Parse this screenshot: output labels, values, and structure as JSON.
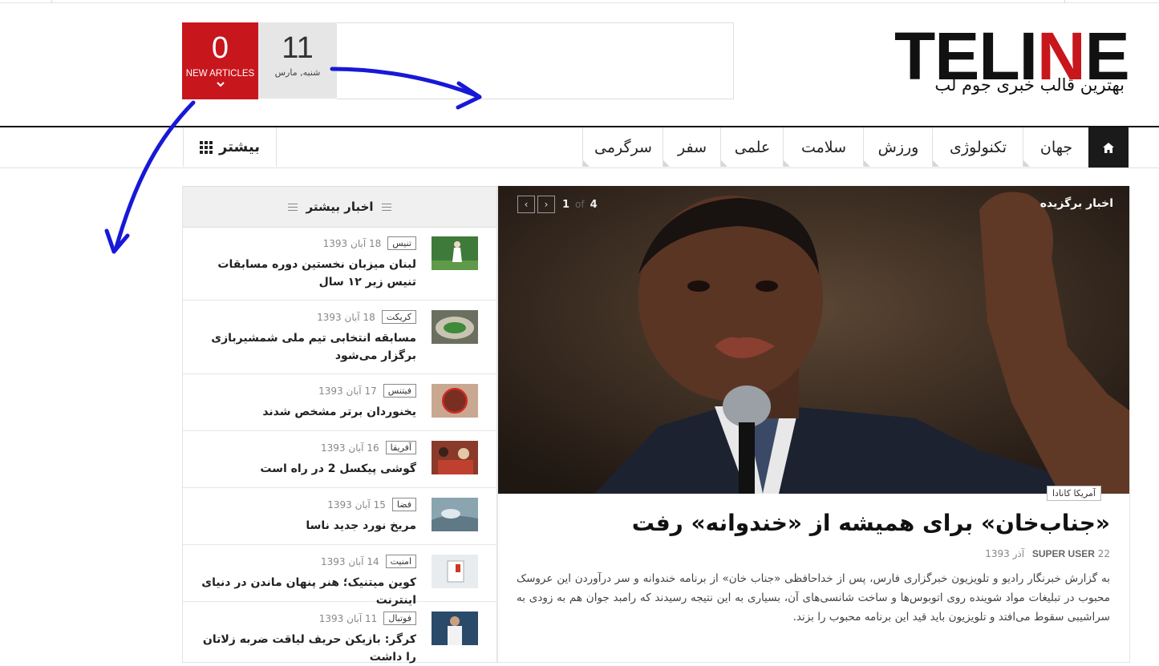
{
  "header": {
    "logo_text_black": "TELI",
    "logo_text_red": "N",
    "logo_text_end": "E",
    "tagline": "بهترین قالب خبری جوم لب",
    "date_day": "11",
    "date_sub": "شنبه, مارس",
    "new_articles_count": "0",
    "new_articles_label": "NEW ARTICLES",
    "brand_red": "#c8161d"
  },
  "nav": {
    "home_icon": "home-icon",
    "items": [
      "جهان",
      "تکنولوژی",
      "ورزش",
      "سلامت",
      "علمی",
      "سفر",
      "سرگرمی"
    ],
    "more_label": "بیشتر",
    "more_icon": "grid-icon"
  },
  "featured": {
    "section_title": "اخبار برگزیده",
    "pager_total": "4",
    "pager_of": "of",
    "pager_current": "1",
    "category": "آمریکا کانادا",
    "headline": "«جناب‌خان» برای همیشه از «خندوانه» رفت",
    "author": "SUPER USER",
    "date": "22 آذر 1393",
    "body": "به گزارش خبرنگار رادیو و تلویزیون خبرگزاری فارس، پس از خداحافظی «جناب خان» از برنامه خندوانه و سر درآوردن این عروسک محبوب در تبلیغات مواد شوینده روی اتوبوس‌ها و ساخت شانسی‌های آن، بسیاری به این نتیجه رسیدند که رامبد جوان هم به زودی به سراشیبی سقوط می‌افتد و تلویزیون باید قید این برنامه محبوب را بزند."
  },
  "sidebar": {
    "title": "اخبار بیشتر",
    "items": [
      {
        "tag": "تنیس",
        "date": "18 آبان 1393",
        "title": "لبنان میزبان نخستین دوره مسابقات تنیس زیر ۱۲ سال"
      },
      {
        "tag": "کریکت",
        "date": "18 آبان 1393",
        "title": "مسابقه انتخابی تیم ملی شمشیربازی برگزار می‌شود"
      },
      {
        "tag": "فیتنس",
        "date": "17 آبان 1393",
        "title": "یخنوردان برتر مشخص شدند"
      },
      {
        "tag": "آفریقا",
        "date": "16 آبان 1393",
        "title": "گوشی پیکسل 2 در راه است"
      },
      {
        "tag": "فضا",
        "date": "15 آبان 1393",
        "title": "مریخ نورد جدید ناسا"
      },
      {
        "tag": "امنیت",
        "date": "14 آبان 1393",
        "title": "کوین میتنیک؛ هنر پنهان ماندن در دنیای اینترنت"
      },
      {
        "tag": "فوتبال",
        "date": "11 آبان 1393",
        "title": "کرگر: بازیکن حریف لیاقت ضربه زلاتان را داشت"
      }
    ]
  },
  "annotation_color": "#1818d8"
}
